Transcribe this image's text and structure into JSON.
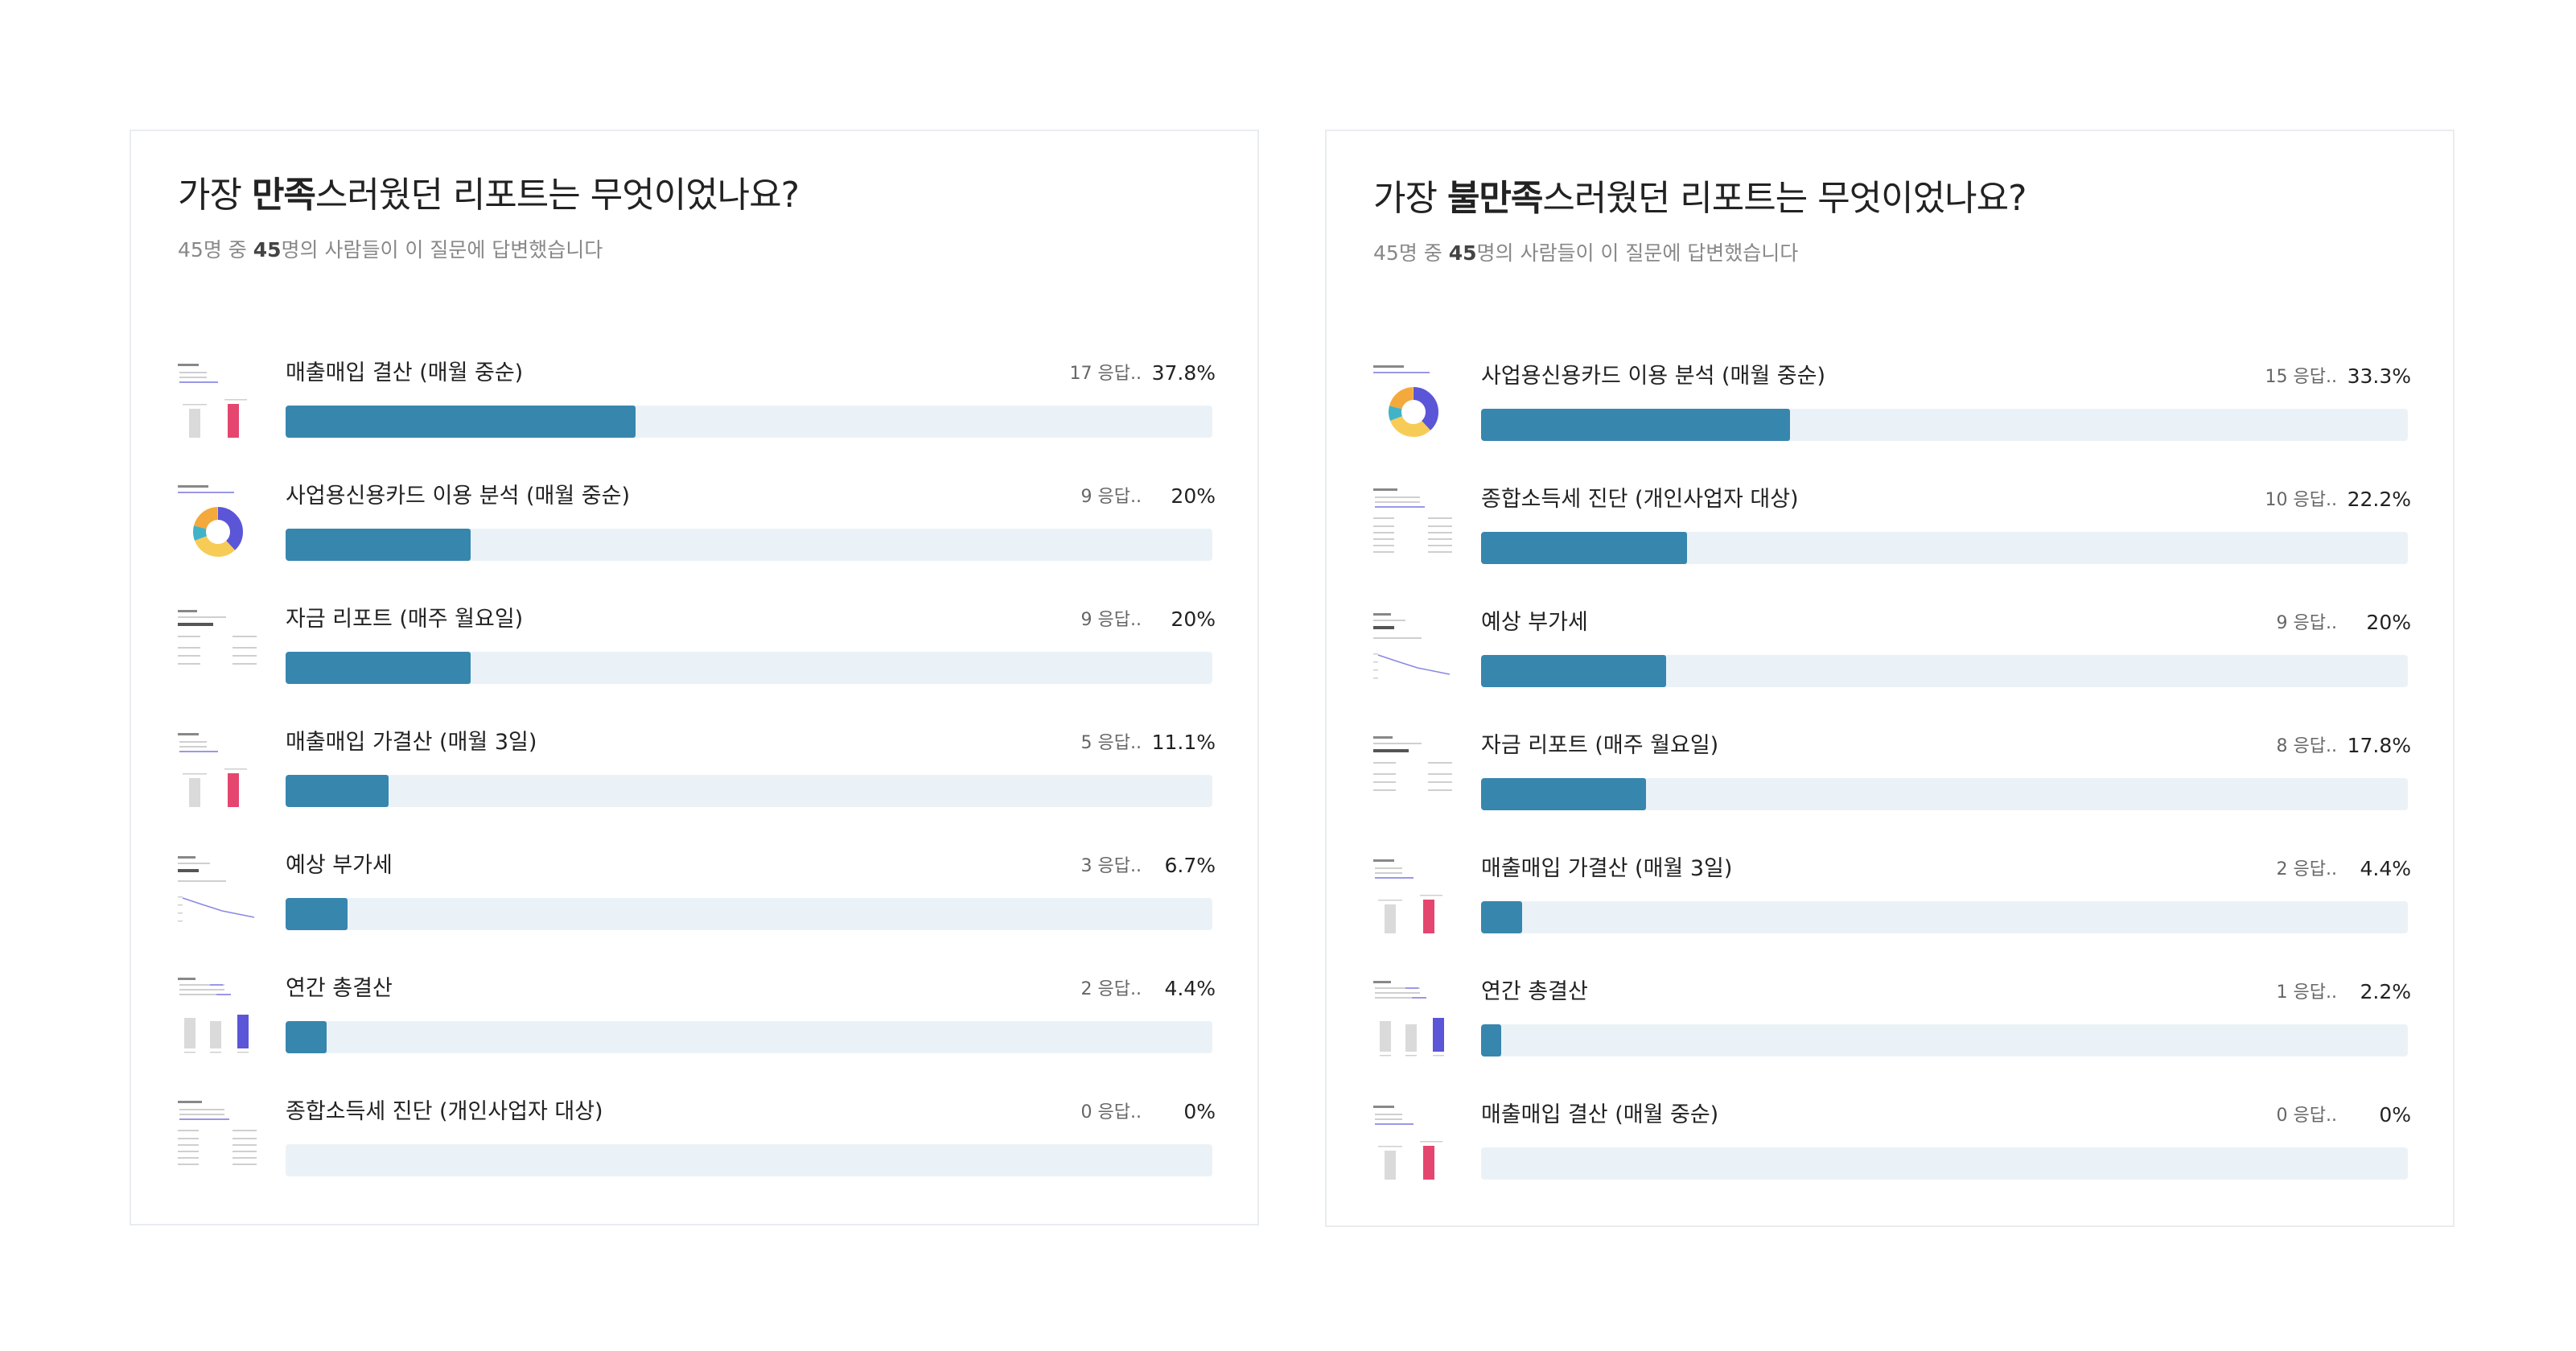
{
  "colors": {
    "bar_fill": "#3786ae",
    "bar_track": "#ebf2f7",
    "thumb_pink": "#e5466f",
    "thumb_purple": "#5b55d8",
    "thumb_orange": "#f3a93b",
    "thumb_yellow": "#f7cc56",
    "thumb_teal": "#40b3c9"
  },
  "panels": [
    {
      "title_pre": "가장 ",
      "title_bold": "만족",
      "title_post": "스러웠던 리포트는 무엇이었나요?",
      "sub_total": "45",
      "sub_mid": "명 중 ",
      "sub_answered": "45",
      "sub_post": "명의 사람들이 이 질문에 답변했습니다",
      "items": [
        {
          "label": "매출매입 결산 (매월 중순)",
          "count": "17 응답..",
          "pct": "37.8%",
          "ratio": 0.378,
          "thumb": "sales-bar-thumbnail"
        },
        {
          "label": "사업용신용카드 이용 분석 (매월 중순)",
          "count": "9 응답..",
          "pct": "20%",
          "ratio": 0.2,
          "thumb": "donut-chart-thumbnail"
        },
        {
          "label": "자금 리포트 (매주 월요일)",
          "count": "9 응답..",
          "pct": "20%",
          "ratio": 0.2,
          "thumb": "fund-table-thumbnail"
        },
        {
          "label": "매출매입 가결산 (매월 3일)",
          "count": "5 응답..",
          "pct": "11.1%",
          "ratio": 0.111,
          "thumb": "sales-bar-thumbnail"
        },
        {
          "label": "예상 부가세",
          "count": "3 응답..",
          "pct": "6.7%",
          "ratio": 0.067,
          "thumb": "vat-line-thumbnail"
        },
        {
          "label": "연간 총결산",
          "count": "2 응답..",
          "pct": "4.4%",
          "ratio": 0.044,
          "thumb": "annual-bar-thumbnail"
        },
        {
          "label": "종합소득세 진단 (개인사업자 대상)",
          "count": "0 응답..",
          "pct": "0%",
          "ratio": 0,
          "thumb": "tax-table-thumbnail"
        }
      ]
    },
    {
      "title_pre": "가장 ",
      "title_bold": "불만족",
      "title_post": "스러웠던 리포트는 무엇이었나요?",
      "sub_total": "45",
      "sub_mid": "명 중 ",
      "sub_answered": "45",
      "sub_post": "명의 사람들이 이 질문에 답변했습니다",
      "items": [
        {
          "label": "사업용신용카드 이용 분석 (매월 중순)",
          "count": "15 응답..",
          "pct": "33.3%",
          "ratio": 0.333,
          "thumb": "donut-chart-thumbnail"
        },
        {
          "label": "종합소득세 진단 (개인사업자 대상)",
          "count": "10 응답..",
          "pct": "22.2%",
          "ratio": 0.222,
          "thumb": "tax-table-thumbnail"
        },
        {
          "label": "예상 부가세",
          "count": "9 응답..",
          "pct": "20%",
          "ratio": 0.2,
          "thumb": "vat-line-thumbnail"
        },
        {
          "label": "자금 리포트 (매주 월요일)",
          "count": "8 응답..",
          "pct": "17.8%",
          "ratio": 0.178,
          "thumb": "fund-table-thumbnail"
        },
        {
          "label": "매출매입 가결산 (매월 3일)",
          "count": "2 응답..",
          "pct": "4.4%",
          "ratio": 0.044,
          "thumb": "sales-bar-thumbnail"
        },
        {
          "label": "연간 총결산",
          "count": "1 응답..",
          "pct": "2.2%",
          "ratio": 0.022,
          "thumb": "annual-bar-thumbnail"
        },
        {
          "label": "매출매입 결산 (매월 중순)",
          "count": "0 응답..",
          "pct": "0%",
          "ratio": 0,
          "thumb": "sales-bar-thumbnail"
        }
      ]
    }
  ]
}
